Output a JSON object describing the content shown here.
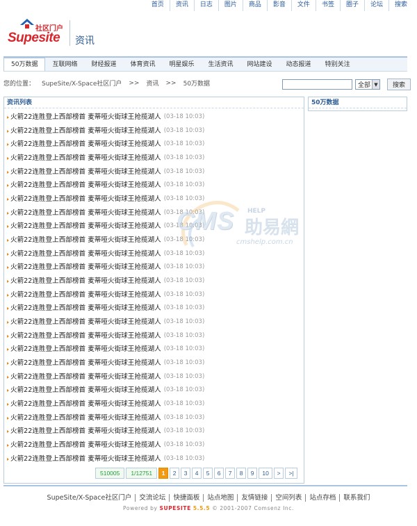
{
  "topnav": [
    "首页",
    "资讯",
    "日志",
    "图片",
    "商品",
    "影音",
    "文件",
    "书签",
    "圈子",
    "论坛",
    "搜索"
  ],
  "logo": {
    "cn": "社区门户",
    "brand_a": "Supe",
    "brand_b": "site"
  },
  "channel_title": "资讯",
  "mainnav": [
    "50万数据",
    "互联网络",
    "财经报道",
    "体育资讯",
    "明星娱乐",
    "生活资讯",
    "网站建设",
    "动态报道",
    "特别关注"
  ],
  "breadcrumb": {
    "label": "您的位置：",
    "items": [
      "SupeSite/X-Space社区门户",
      "资讯",
      "50万数据"
    ],
    "sep": ">>"
  },
  "search": {
    "value": "",
    "select_value": "全部",
    "button": "搜索"
  },
  "list_panel": {
    "title": "资讯列表",
    "items": [
      {
        "title": "火箭22连胜登上西部榜首 麦蒂哑火街球王抢揽湖人",
        "time": "(03-18 10:03)"
      },
      {
        "title": "火箭22连胜登上西部榜首 麦蒂哑火街球王抢揽湖人",
        "time": "(03-18 10:03)"
      },
      {
        "title": "火箭22连胜登上西部榜首 麦蒂哑火街球王抢揽湖人",
        "time": "(03-18 10:03)"
      },
      {
        "title": "火箭22连胜登上西部榜首 麦蒂哑火街球王抢揽湖人",
        "time": "(03-18 10:03)"
      },
      {
        "title": "火箭22连胜登上西部榜首 麦蒂哑火街球王抢揽湖人",
        "time": "(03-18 10:03)"
      },
      {
        "title": "火箭22连胜登上西部榜首 麦蒂哑火街球王抢揽湖人",
        "time": "(03-18 10:03)"
      },
      {
        "title": "火箭22连胜登上西部榜首 麦蒂哑火街球王抢揽湖人",
        "time": "(03-18 10:03)"
      },
      {
        "title": "火箭22连胜登上西部榜首 麦蒂哑火街球王抢揽湖人",
        "time": "(03-18 10:03)"
      },
      {
        "title": "火箭22连胜登上西部榜首 麦蒂哑火街球王抢揽湖人",
        "time": "(03-18 10:03)"
      },
      {
        "title": "火箭22连胜登上西部榜首 麦蒂哑火街球王抢揽湖人",
        "time": "(03-18 10:03)"
      },
      {
        "title": "火箭22连胜登上西部榜首 麦蒂哑火街球王抢揽湖人",
        "time": "(03-18 10:03)"
      },
      {
        "title": "火箭22连胜登上西部榜首 麦蒂哑火街球王抢揽湖人",
        "time": "(03-18 10:03)"
      },
      {
        "title": "火箭22连胜登上西部榜首 麦蒂哑火街球王抢揽湖人",
        "time": "(03-18 10:03)"
      },
      {
        "title": "火箭22连胜登上西部榜首 麦蒂哑火街球王抢揽湖人",
        "time": "(03-18 10:03)"
      },
      {
        "title": "火箭22连胜登上西部榜首 麦蒂哑火街球王抢揽湖人",
        "time": "(03-18 10:03)"
      },
      {
        "title": "火箭22连胜登上西部榜首 麦蒂哑火街球王抢揽湖人",
        "time": "(03-18 10:03)"
      },
      {
        "title": "火箭22连胜登上西部榜首 麦蒂哑火街球王抢揽湖人",
        "time": "(03-18 10:03)"
      },
      {
        "title": "火箭22连胜登上西部榜首 麦蒂哑火街球王抢揽湖人",
        "time": "(03-18 10:03)"
      },
      {
        "title": "火箭22连胜登上西部榜首 麦蒂哑火街球王抢揽湖人",
        "time": "(03-18 10:03)"
      },
      {
        "title": "火箭22连胜登上西部榜首 麦蒂哑火街球王抢揽湖人",
        "time": "(03-18 10:03)"
      },
      {
        "title": "火箭22连胜登上西部榜首 麦蒂哑火街球王抢揽湖人",
        "time": "(03-18 10:03)"
      },
      {
        "title": "火箭22连胜登上西部榜首 麦蒂哑火街球王抢揽湖人",
        "time": "(03-18 10:03)"
      },
      {
        "title": "火箭22连胜登上西部榜首 麦蒂哑火街球王抢揽湖人",
        "time": "(03-18 10:03)"
      },
      {
        "title": "火箭22连胜登上西部榜首 麦蒂哑火街球王抢揽湖人",
        "time": "(03-18 10:03)"
      },
      {
        "title": "火箭22连胜登上西部榜首 麦蒂哑火街球王抢揽湖人",
        "time": "(03-18 10:03)"
      },
      {
        "title": "火箭22连胜登上西部榜首 麦蒂哑火街球王抢揽湖人",
        "time": "(03-18 10:03)"
      }
    ]
  },
  "pager": {
    "total": "510005",
    "pages": "1/12751",
    "numbers": [
      "1",
      "2",
      "3",
      "4",
      "5",
      "6",
      "7",
      "8",
      "9",
      "10"
    ],
    "current": "1",
    "next": ">",
    "last": ">|"
  },
  "sidebar": {
    "title": "50万数据"
  },
  "watermark": {
    "cms": "CMS",
    "help": "HELP",
    "han": "助易網",
    "url": "cmshelp.com.cn"
  },
  "footer": {
    "links": [
      "SupeSite/X-Space社区门户",
      "交流论坛",
      "快捷面板",
      "站点地图",
      "友情链接",
      "空间列表",
      "站点存档",
      "联系我们"
    ],
    "powered_pre": "Powered by",
    "powered_brand": "SUPESITE",
    "powered_ver": "5.5.5",
    "copyright": "© 2001-2007 Comsenz Inc."
  },
  "colors": {
    "brand_red": "#d8262d",
    "brand_blue": "#2060b0",
    "link_blue": "#2d5d94",
    "pager_current": "#f29a14"
  }
}
